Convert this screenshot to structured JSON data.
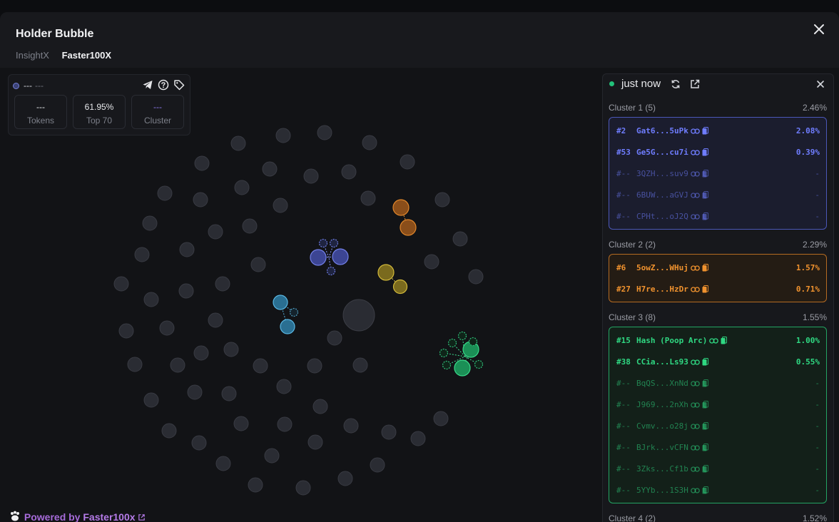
{
  "modal": {
    "title": "Holder Bubble",
    "tabs": [
      "InsightX",
      "Faster100X"
    ],
    "active_tab": 1
  },
  "info": {
    "name": "---",
    "symbol": "---",
    "stats": [
      {
        "value": "---",
        "label": "Tokens"
      },
      {
        "value": "61.95%",
        "label": "Top 70"
      },
      {
        "value": "---",
        "label": "Cluster"
      }
    ]
  },
  "panel": {
    "status": "just now",
    "clusters": [
      {
        "label": "Cluster 1 (5)",
        "pct": "2.46%",
        "color": "#6f7dff",
        "holders": [
          {
            "rank": "#2",
            "addr": "Gat6...5uPk",
            "pct": "2.08%",
            "active": true
          },
          {
            "rank": "#53",
            "addr": "Ge5G...cu7i",
            "pct": "0.39%",
            "active": true
          },
          {
            "rank": "#--",
            "addr": "3QZH...suv9",
            "pct": "-",
            "active": false
          },
          {
            "rank": "#--",
            "addr": "6BUW...aGVJ",
            "pct": "-",
            "active": false
          },
          {
            "rank": "#--",
            "addr": "CPHt...oJ2Q",
            "pct": "-",
            "active": false
          }
        ]
      },
      {
        "label": "Cluster 2 (2)",
        "pct": "2.29%",
        "color": "#f0922e",
        "holders": [
          {
            "rank": "#6",
            "addr": "5owZ...WHuj",
            "pct": "1.57%",
            "active": true
          },
          {
            "rank": "#27",
            "addr": "H7re...HzDr",
            "pct": "0.71%",
            "active": true
          }
        ]
      },
      {
        "label": "Cluster 3 (8)",
        "pct": "1.55%",
        "color": "#2fd882",
        "holders": [
          {
            "rank": "#15",
            "addr": "Hash (Poop Arc)",
            "pct": "1.00%",
            "active": true
          },
          {
            "rank": "#38",
            "addr": "CCia...Ls93",
            "pct": "0.55%",
            "active": true
          },
          {
            "rank": "#--",
            "addr": "BqQS...XnNd",
            "pct": "-",
            "active": false
          },
          {
            "rank": "#--",
            "addr": "J969...2nXh",
            "pct": "-",
            "active": false
          },
          {
            "rank": "#--",
            "addr": "Cvmv...o28j",
            "pct": "-",
            "active": false
          },
          {
            "rank": "#--",
            "addr": "BJrk...vCFN",
            "pct": "-",
            "active": false
          },
          {
            "rank": "#--",
            "addr": "3Zks...Cf1b",
            "pct": "-",
            "active": false
          },
          {
            "rank": "#--",
            "addr": "5YYb...1S3H",
            "pct": "-",
            "active": false
          }
        ]
      },
      {
        "label": "Cluster 4 (2)",
        "pct": "1.52%",
        "color": "#d8c23a",
        "holders": []
      }
    ]
  },
  "footer": {
    "powered_prefix": "Powered by",
    "brand": "Faster100x"
  },
  "icons": [
    "close-icon",
    "telegram-icon",
    "help-icon",
    "tag-icon",
    "refresh-icon",
    "external-link-icon",
    "link-icon",
    "copy-icon",
    "paw-icon"
  ]
}
